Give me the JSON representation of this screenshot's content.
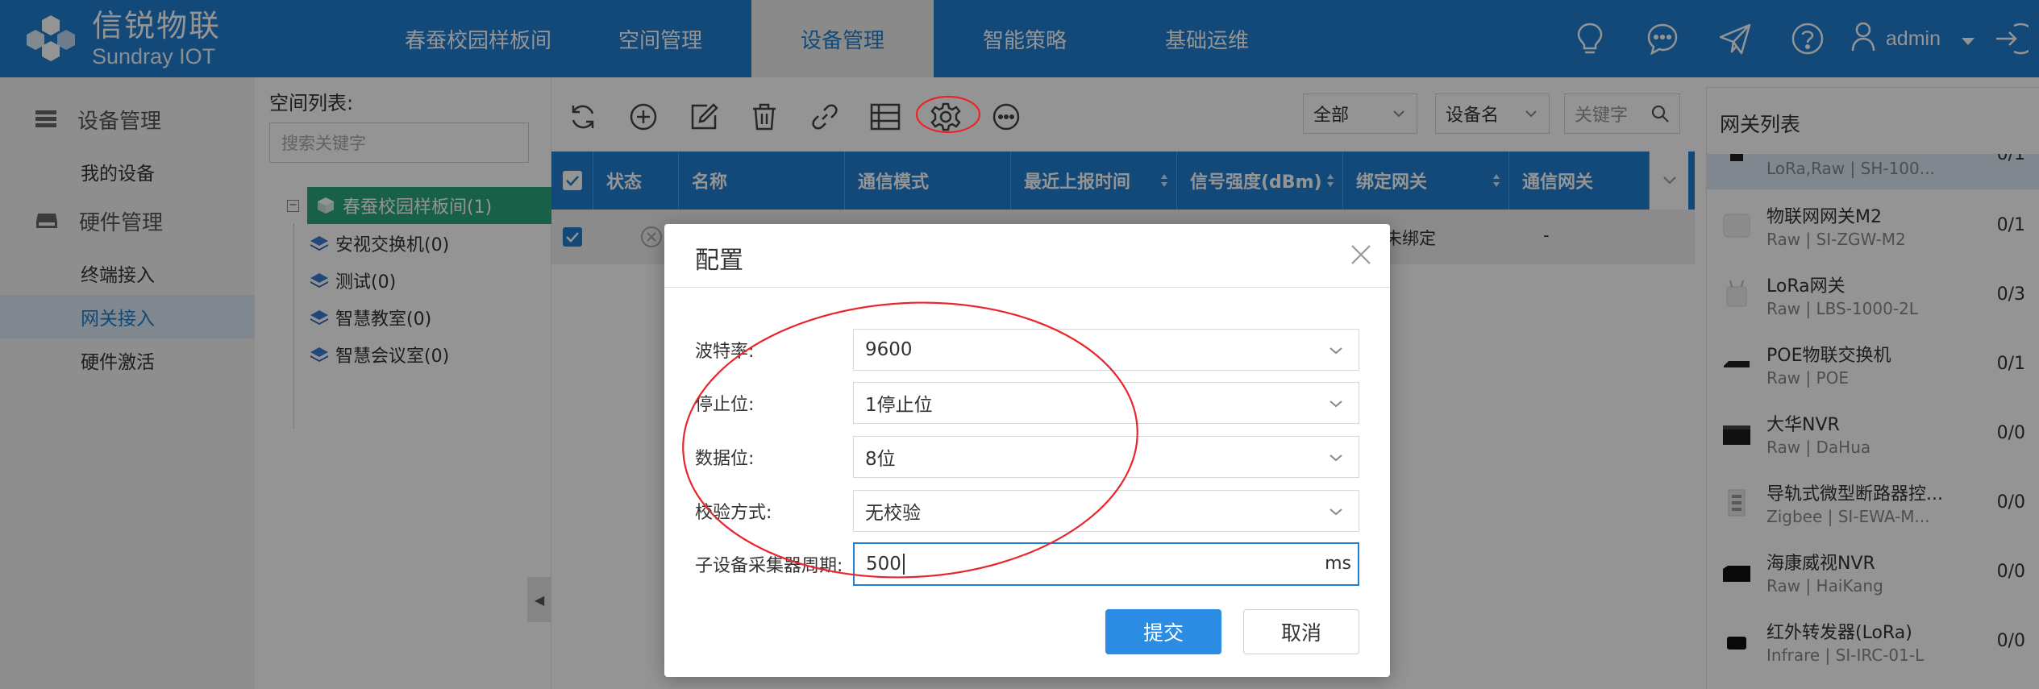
{
  "header": {
    "logo_cn": "信锐物联",
    "logo_en": "Sundray IOT",
    "nav": [
      {
        "label": "春蚕校园样板间"
      },
      {
        "label": "空间管理"
      },
      {
        "label": "设备管理"
      },
      {
        "label": "智能策略"
      },
      {
        "label": "基础运维"
      }
    ],
    "active_nav": "设备管理",
    "user": "admin",
    "icons": [
      "bulb-icon",
      "message-icon",
      "send-icon",
      "help-icon",
      "user-icon",
      "logout-icon"
    ]
  },
  "sidebar": {
    "groups": [
      {
        "label": "设备管理",
        "icon": "device-list-icon",
        "items": [
          {
            "label": "我的设备"
          }
        ]
      },
      {
        "label": "硬件管理",
        "icon": "hardware-icon",
        "items": [
          {
            "label": "终端接入"
          },
          {
            "label": "网关接入"
          },
          {
            "label": "硬件激活"
          }
        ]
      }
    ],
    "active_item": "网关接入"
  },
  "space_tree": {
    "title": "空间列表:",
    "search_placeholder": "搜索关键字",
    "root": "春蚕校园样板间(1)",
    "children": [
      {
        "label": "安视交换机(0)"
      },
      {
        "label": "测试(0)"
      },
      {
        "label": "智慧教室(0)"
      },
      {
        "label": "智慧会议室(0)"
      }
    ]
  },
  "toolbar": {
    "icons": [
      "refresh-icon",
      "add-icon",
      "edit-icon",
      "delete-icon",
      "link-icon",
      "list-icon",
      "settings-icon",
      "more-icon"
    ],
    "filter_scope": "全部",
    "filter_field": "设备名",
    "keyword_placeholder": "关键字"
  },
  "table": {
    "columns": [
      {
        "label": "状态"
      },
      {
        "label": "名称"
      },
      {
        "label": "通信模式"
      },
      {
        "label": "最近上报时间"
      },
      {
        "label": "信号强度(dBm)"
      },
      {
        "label": "绑定网关"
      },
      {
        "label": "通信网关"
      }
    ],
    "rows": [
      {
        "bind_gateway": "未绑定",
        "comm_gateway": "-"
      }
    ]
  },
  "gateway_list": {
    "title": "网关列表",
    "items": [
      {
        "name": "",
        "sub": "LoRa,Raw | SH-100...",
        "count": "0/1",
        "thumb": "device-thumb-icon"
      },
      {
        "name": "物联网网关M2",
        "sub": "Raw | SI-ZGW-M2",
        "count": "0/1",
        "thumb": "gateway-thumb-icon"
      },
      {
        "name": "LoRa网关",
        "sub": "Raw | LBS-1000-2L",
        "count": "0/3",
        "thumb": "lora-thumb-icon"
      },
      {
        "name": "POE物联交换机",
        "sub": "Raw | POE",
        "count": "0/1",
        "thumb": "switch-thumb-icon"
      },
      {
        "name": "大华NVR",
        "sub": "Raw | DaHua",
        "count": "0/0",
        "thumb": "nvr-thumb-icon"
      },
      {
        "name": "导轨式微型断路器控...",
        "sub": "Zigbee | SI-EWA-M...",
        "count": "0/0",
        "thumb": "breaker-thumb-icon"
      },
      {
        "name": "海康威视NVR",
        "sub": "Raw | HaiKang",
        "count": "0/0",
        "thumb": "nvr-thumb-icon"
      },
      {
        "name": "红外转发器(LoRa)",
        "sub": "Infrare | SI-IRC-01-L",
        "count": "0/0",
        "thumb": "ir-thumb-icon"
      }
    ]
  },
  "dialog": {
    "title": "配置",
    "fields": [
      {
        "label": "波特率:",
        "value": "9600",
        "type": "select"
      },
      {
        "label": "停止位:",
        "value": "1停止位",
        "type": "select"
      },
      {
        "label": "数据位:",
        "value": "8位",
        "type": "select"
      },
      {
        "label": "校验方式:",
        "value": "无校验",
        "type": "select"
      },
      {
        "label": "子设备采集器周期:",
        "value": "500",
        "type": "input",
        "unit": "ms"
      }
    ],
    "submit": "提交",
    "cancel": "取消"
  },
  "colors": {
    "brand": "#1f7ed0",
    "tree_selected": "#2aa87c",
    "submit": "#2b8ce3",
    "annotation": "#e8262b"
  }
}
